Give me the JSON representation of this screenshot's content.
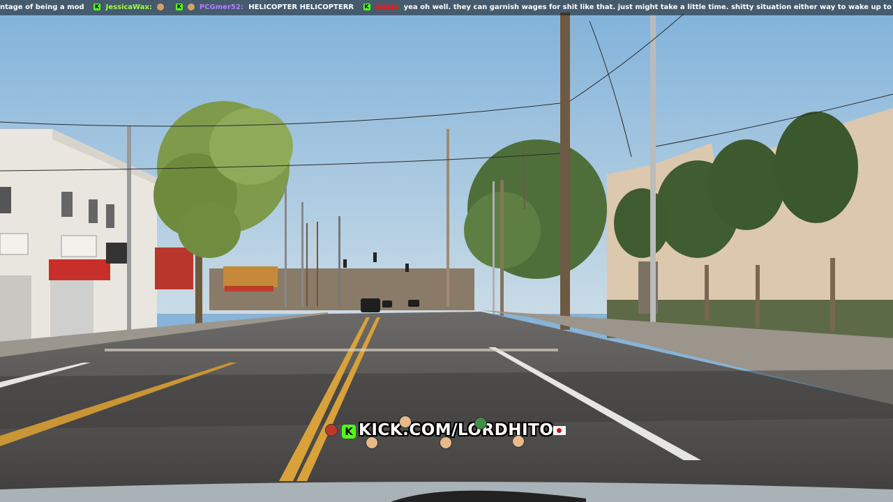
{
  "stream": {
    "chat_ticker": [
      {
        "user": "",
        "message": "ntage of being a mod",
        "color": "#ffffff"
      },
      {
        "user": "JessicaWax:",
        "message": "",
        "color": "#9cff3e"
      },
      {
        "user": "PCGmer52:",
        "message": "HELICOPTER HELICOPTERR",
        "color": "#b77cff"
      },
      {
        "user": "",
        "message": "yea oh well. they can garnish wages for shit like that. just might take a little time. shitty situation either way to wake up to that",
        "color": "#e02020"
      }
    ],
    "watermark": {
      "platform_icon": "kick-logo-icon",
      "text": "KICK.COM/LORDHITO",
      "flag_icon": "japan-flag-icon"
    }
  },
  "scene": {
    "description_icon": "street-driving-view",
    "sky_color": "#8fb9dc",
    "road_color": "#4c4b4a",
    "line_yellow": "#d9a13a",
    "line_white": "#e8e8e8"
  }
}
